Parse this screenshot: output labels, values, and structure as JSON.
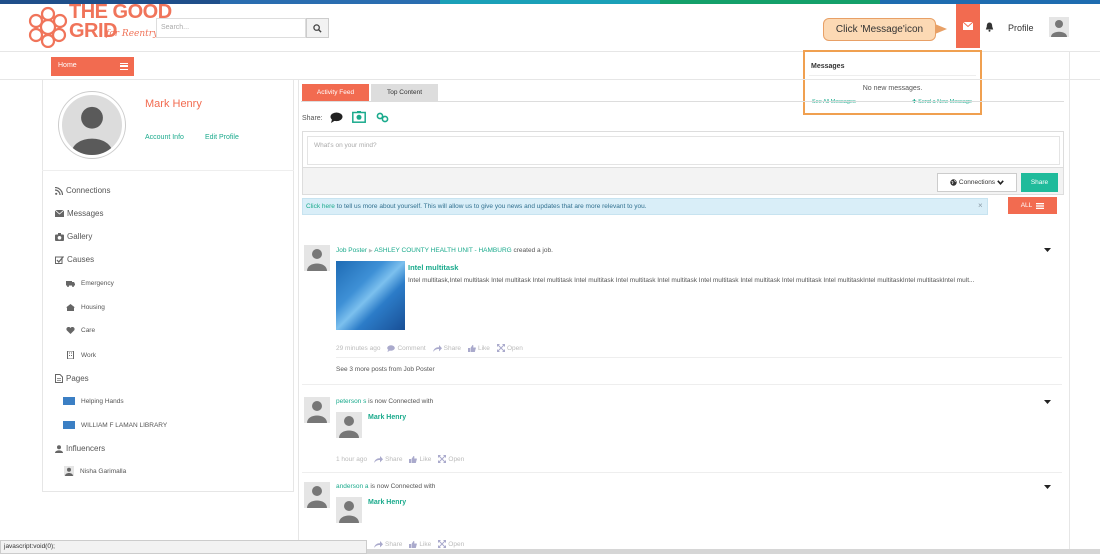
{
  "brand": {
    "logo_text_line1": "THE GOOD",
    "logo_text_line2": "GRID",
    "logo_script": "for Reentry",
    "accent_color": "#f26b50",
    "teal_color": "#1aaa8c"
  },
  "header": {
    "search_placeholder": "Search...",
    "search_icon": "search-icon",
    "callout_text": "Click 'Message'icon",
    "message_icon": "envelope-icon",
    "notification_icon": "bell-icon",
    "profile_label": "Profile"
  },
  "messages_dropdown": {
    "title": "Messages",
    "empty_text": "No new messages.",
    "see_all_label": "See All Messages",
    "send_new_label": "Send a New Message"
  },
  "home_button": {
    "label": "Home"
  },
  "profile": {
    "name": "Mark Henry",
    "account_info_label": "Account Info",
    "edit_profile_label": "Edit Profile"
  },
  "sidebar": {
    "connections": "Connections",
    "messages": "Messages",
    "gallery": "Gallery",
    "causes": "Causes",
    "cause_items": [
      "Emergency",
      "Housing",
      "Care",
      "Work"
    ],
    "pages": "Pages",
    "page_items": [
      "Helping Hands",
      "WILLIAM F LAMAN LIBRARY"
    ],
    "influencers": "Influencers",
    "influencer_items": [
      "Nisha Garimalla"
    ]
  },
  "tabs": {
    "activity_feed": "Activity Feed",
    "top_content": "Top Content"
  },
  "composer": {
    "share_label": "Share:",
    "placeholder": "What's on your mind?",
    "connections_label": "Connections",
    "share_button": "Share"
  },
  "alert": {
    "link_text": "Click here",
    "text": " to tell us more about yourself. This will allow us to give you news and updates that are more relevant to you.",
    "close": "×"
  },
  "filter": {
    "all_label": "ALL"
  },
  "feed": {
    "post1": {
      "author": "Job Poster",
      "arrow": "▶",
      "target": "ASHLEY COUNTY HEALTH UNIT - HAMBURG",
      "action": "created a job.",
      "job_title": "Intel multitask",
      "job_desc": "Intel multitask,Intel multitask Intel multitask Intel multitask Intel multitask Intel multitask Intel multitask Intel multitask Intel multitask Intel multitask  Intel multitaskIntel multitaskIntel multitaskIntel mult...",
      "time": "29 minutes ago",
      "comment": "Comment",
      "share": "Share",
      "like": "Like",
      "open": "Open",
      "see_more": "See 3 more posts from Job Poster"
    },
    "post2": {
      "author": "peterson s",
      "action": " is now Connected with",
      "connected_name": "Mark Henry",
      "time": "1 hour ago",
      "share": "Share",
      "like": "Like",
      "open": "Open"
    },
    "post3": {
      "author": "anderson a",
      "action": " is now Connected with",
      "connected_name": "Mark Henry",
      "share": "Share",
      "like": "Like",
      "open": "Open"
    }
  },
  "statusbar": {
    "text": "javascript:void(0);"
  }
}
